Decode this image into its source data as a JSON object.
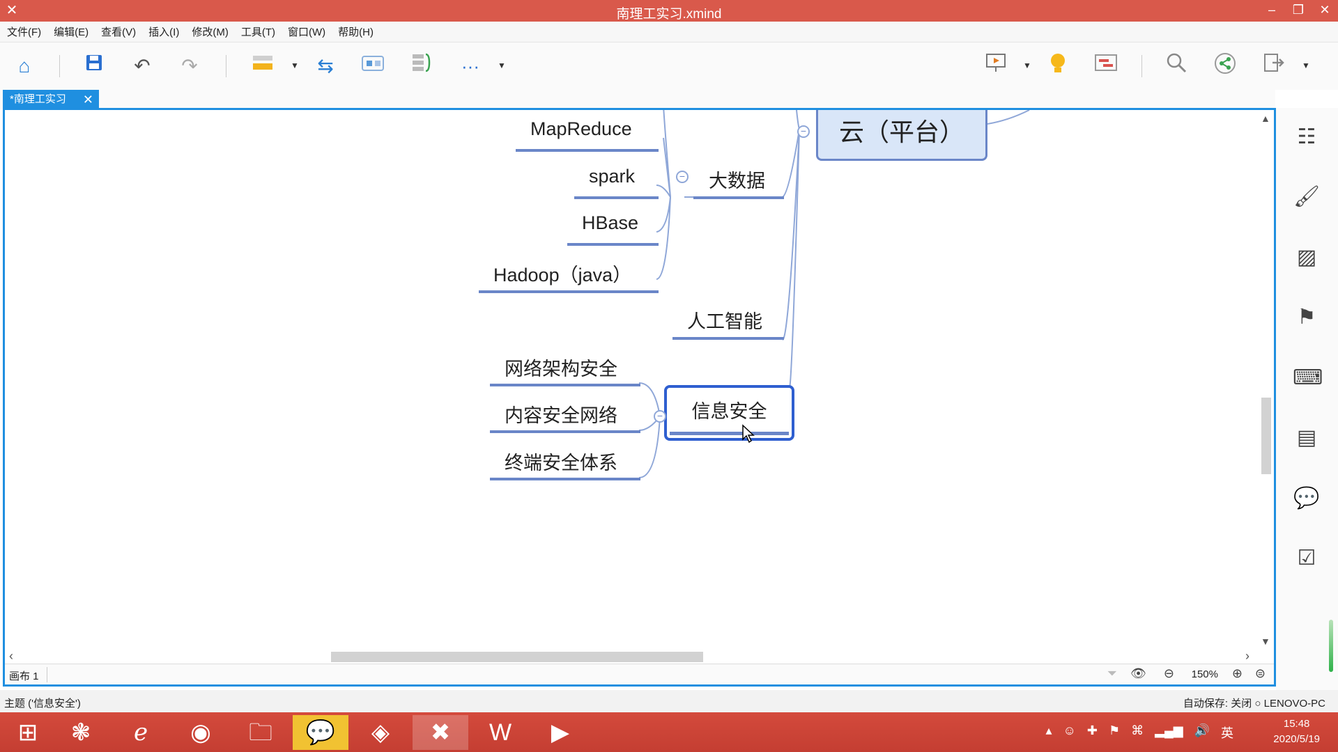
{
  "window": {
    "title": "南理工实习.xmind",
    "minimize": "–",
    "restore": "❐",
    "close": "✕"
  },
  "menu": [
    "文件(F)",
    "编辑(E)",
    "查看(V)",
    "插入(I)",
    "修改(M)",
    "工具(T)",
    "窗口(W)",
    "帮助(H)"
  ],
  "toolbar": {
    "icons": [
      "home-icon",
      "save-icon",
      "undo-icon",
      "redo-icon",
      "topic-icon",
      "relationship-icon",
      "boundary-icon",
      "summary-icon",
      "more-icon",
      "presentation-icon",
      "idea-icon",
      "gantt-icon",
      "search-icon",
      "share-icon",
      "export-icon"
    ],
    "more_label": "···"
  },
  "tab": {
    "label": "*南理工实习",
    "close": "✕"
  },
  "mindmap": {
    "root": "云（平台）",
    "branches": {
      "bigdata": {
        "label": "大数据",
        "children": [
          "MapReduce",
          "spark",
          "HBase",
          "Hadoop（java）"
        ]
      },
      "ai": {
        "label": "人工智能"
      },
      "security": {
        "label": "信息安全",
        "children": [
          "网络架构安全",
          "内容安全网络",
          "终端安全体系"
        ]
      }
    }
  },
  "sheetbar": {
    "sheet": "画布 1",
    "zoom": "150%"
  },
  "status": {
    "left": "主题 ('信息安全')",
    "right": "自动保存: 关闭   ○ LENOVO-PC"
  },
  "taskbar": {
    "apps": [
      "start",
      "app-1",
      "ie",
      "chrome",
      "explorer",
      "wechat",
      "app-2",
      "xmind",
      "word",
      "player"
    ],
    "lang": "英",
    "time": "15:48",
    "date": "2020/5/19"
  },
  "colors": {
    "accent": "#1f8fe0",
    "titlebar": "#d9594b",
    "branch": "#6a86c8"
  }
}
